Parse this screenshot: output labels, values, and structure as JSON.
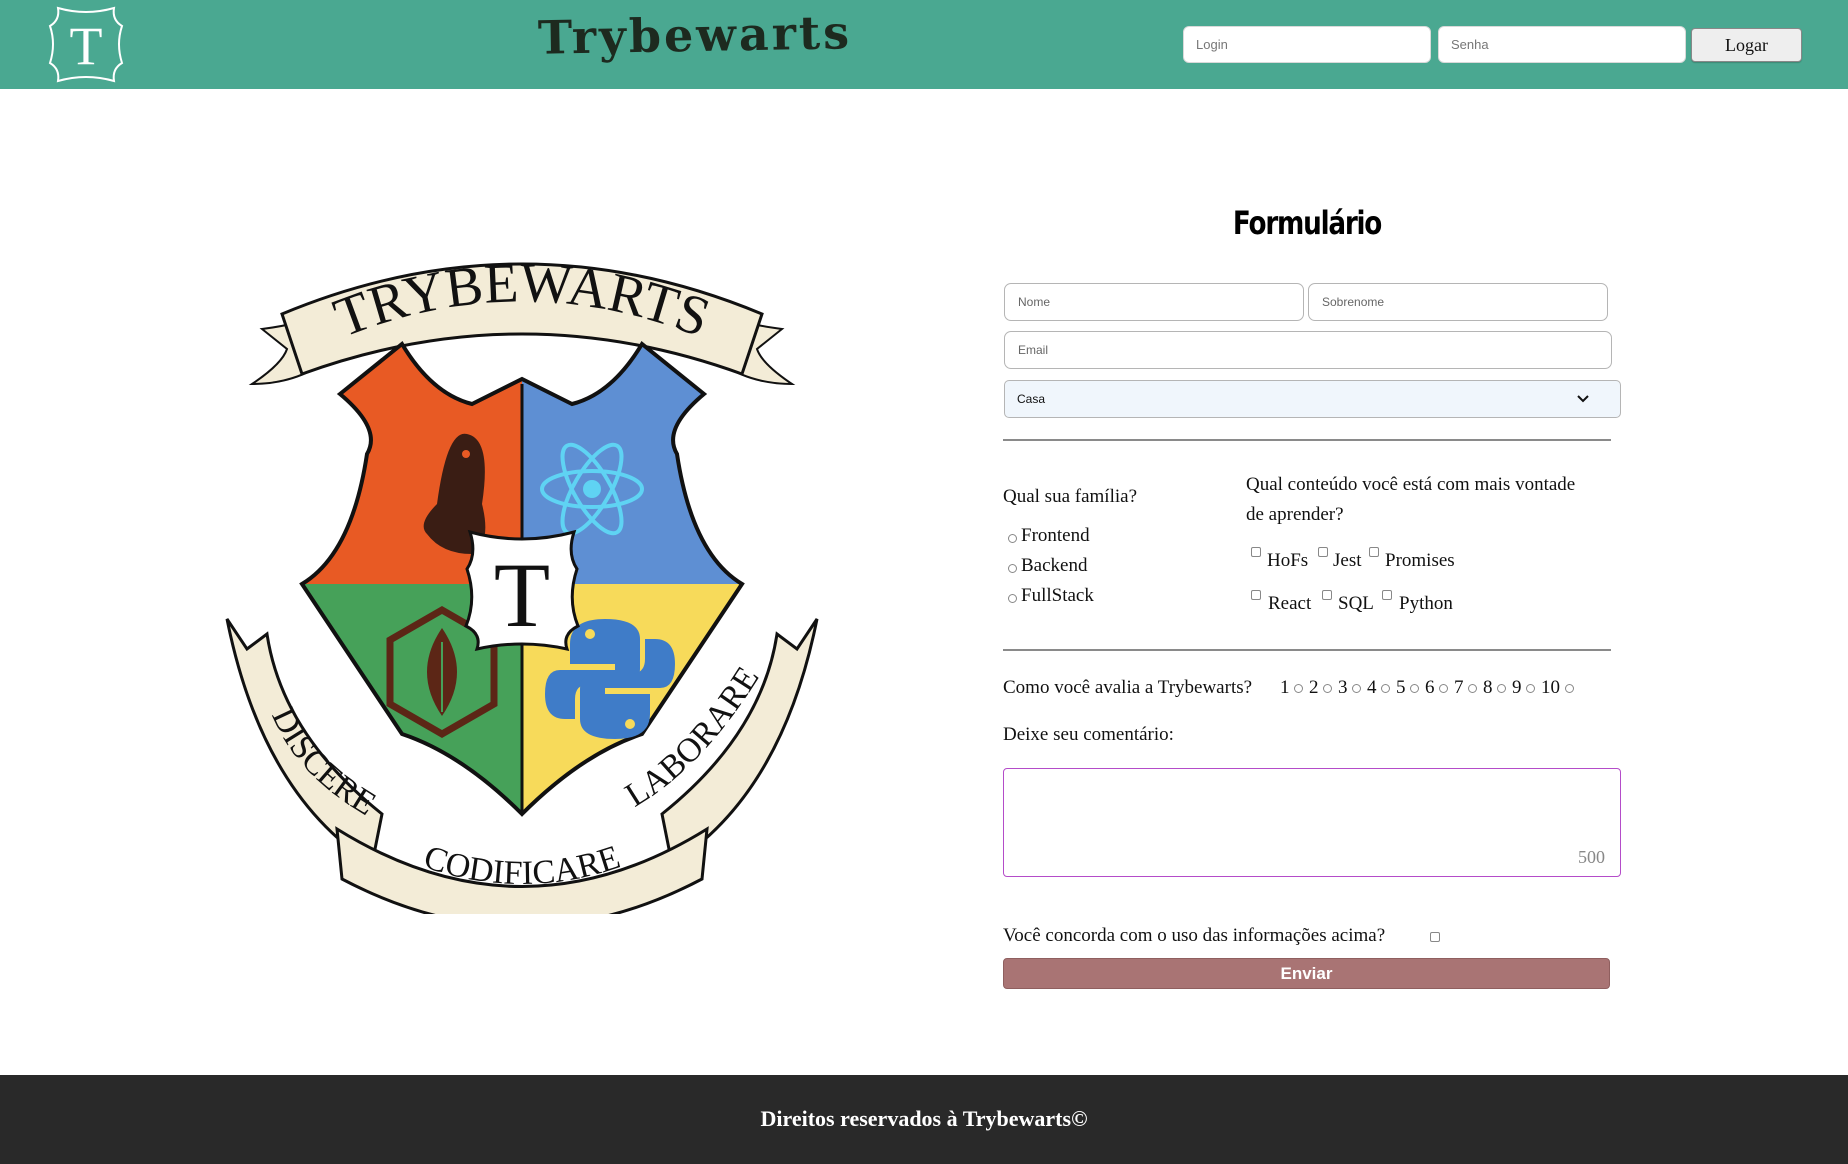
{
  "header": {
    "logo_letter": "T",
    "brand": "Trybewarts",
    "login_placeholder": "Login",
    "password_placeholder": "Senha",
    "login_button": "Logar",
    "bg_color": "#4aa891"
  },
  "crest": {
    "top_banner": "TRYBEWARTS",
    "center_letter": "T",
    "motto_left": "DISCERE",
    "motto_center": "CODIFICARE",
    "motto_right": "LABORARE"
  },
  "form": {
    "title": "Formulário",
    "name_placeholder": "Nome",
    "lastname_placeholder": "Sobrenome",
    "email_placeholder": "Email",
    "house_select_value": "Casa",
    "family_question": "Qual sua família?",
    "family_options": [
      "Frontend",
      "Backend",
      "FullStack"
    ],
    "content_question_line1": "Qual conteúdo você está com mais vontade",
    "content_question_line2": "de aprender?",
    "content_options": [
      "HoFs",
      "Jest",
      "Promises",
      "React",
      "SQL",
      "Python"
    ],
    "rating_question": "Como você avalia a Trybewarts?",
    "rating_options": [
      "1",
      "2",
      "3",
      "4",
      "5",
      "6",
      "7",
      "8",
      "9",
      "10"
    ],
    "comment_label": "Deixe seu comentário:",
    "char_counter": "500",
    "agreement_label": "Você concorda com o uso das informações acima?",
    "submit_label": "Enviar",
    "submit_color": "#a97474",
    "textarea_border_color": "#b44cc9"
  },
  "footer": {
    "text": "Direitos reservados à Trybewarts©",
    "bg_color": "#292929"
  }
}
